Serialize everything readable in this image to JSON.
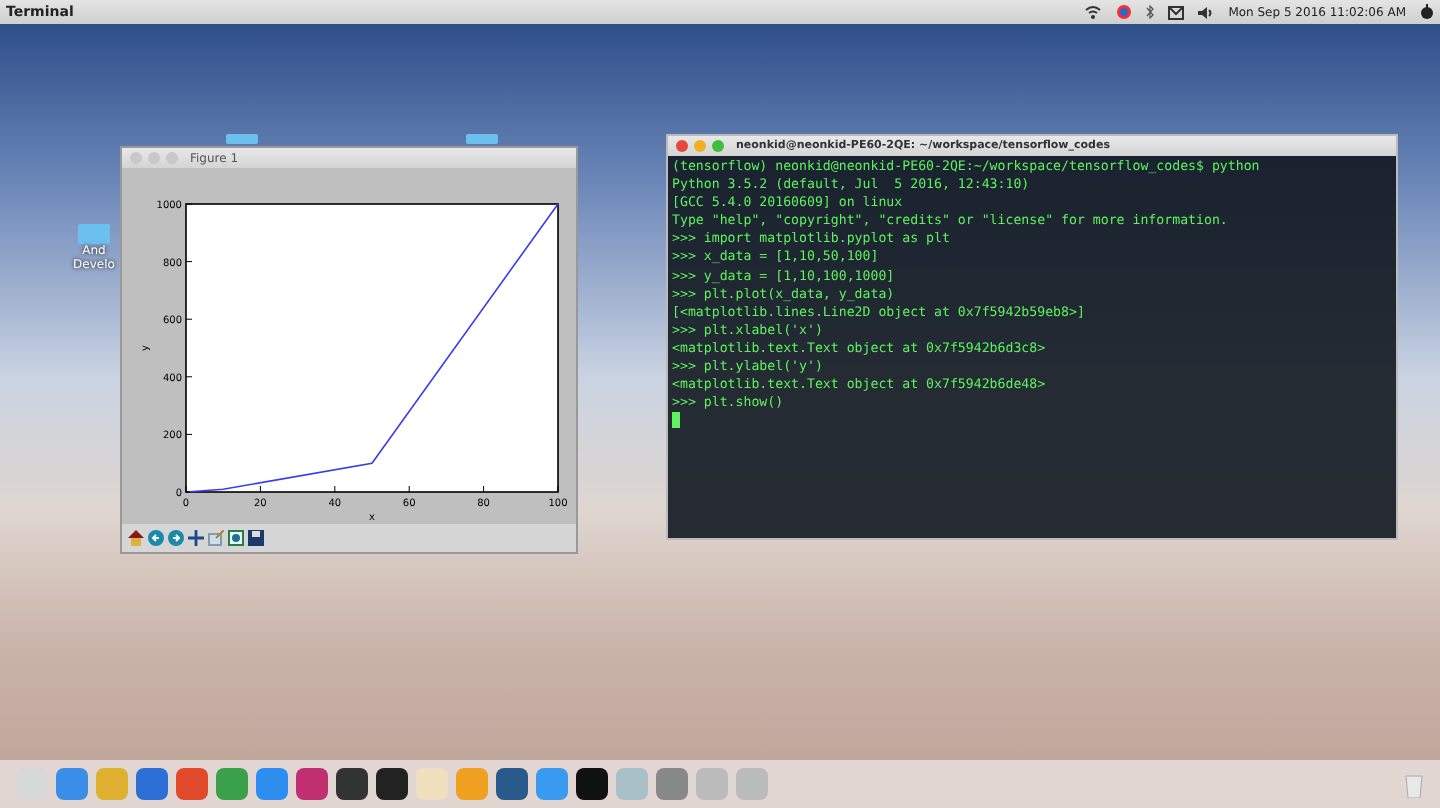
{
  "top_bar": {
    "app_name": "Terminal",
    "clock": "Mon Sep 5 2016 11:02:06 AM"
  },
  "desktop_icons": [
    {
      "label_lines": [
        "And",
        "Develo"
      ]
    }
  ],
  "figure_window": {
    "title": "Figure 1",
    "chart_data": {
      "type": "line",
      "xlabel": "x",
      "ylabel": "y",
      "x": [
        1,
        10,
        50,
        100
      ],
      "series": [
        {
          "color": "#3a3aef",
          "values": [
            1,
            10,
            100,
            1000
          ]
        }
      ],
      "xlim": [
        0,
        100
      ],
      "ylim": [
        0,
        1000
      ],
      "xticks": [
        0,
        20,
        40,
        60,
        80,
        100
      ],
      "yticks": [
        0,
        200,
        400,
        600,
        800,
        1000
      ]
    }
  },
  "terminal": {
    "title": "neonkid@neonkid-PE60-2QE: ~/workspace/tensorflow_codes",
    "lines": [
      "(tensorflow) neonkid@neonkid-PE60-2QE:~/workspace/tensorflow_codes$ python",
      "Python 3.5.2 (default, Jul  5 2016, 12:43:10)",
      "[GCC 5.4.0 20160609] on linux",
      "Type \"help\", \"copyright\", \"credits\" or \"license\" for more information.",
      ">>> import matplotlib.pyplot as plt",
      ">>> x_data = [1,10,50,100]",
      ">>> y_data = [1,10,100,1000]",
      ">>> plt.plot(x_data, y_data)",
      "[<matplotlib.lines.Line2D object at 0x7f5942b59eb8>]",
      ">>> plt.xlabel('x')",
      "<matplotlib.text.Text object at 0x7f5942b6d3c8>",
      ">>> plt.ylabel('y')",
      "<matplotlib.text.Text object at 0x7f5942b6de48>",
      ">>> plt.show()"
    ]
  }
}
